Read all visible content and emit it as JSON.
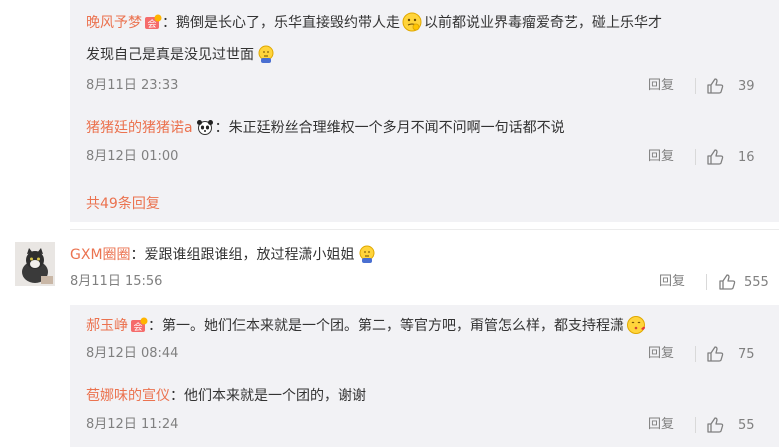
{
  "colors": {
    "username": "#eb7350",
    "meta": "#808080",
    "reply_bg": "#f2f2f5",
    "text": "#333333"
  },
  "thread1": {
    "replies": [
      {
        "user": "晚风予梦",
        "badge_icon": "vip-badge-icon",
        "text_a": "：鹅倒是长心了，乐华直接毁约带人走",
        "emoji_1": "thinking-face-icon",
        "text_b": "以前都说业界毒瘤爱奇艺，碰上乐华才",
        "text_c": "发现自己是真是没见过世面",
        "emoji_2": "sweat-face-icon",
        "time": "8月11日 23:33",
        "reply_label": "回复",
        "likes": "39"
      },
      {
        "user": "猪猪廷的猪猪诺a",
        "badge_icon": "panda-icon",
        "text_a": "：朱正廷粉丝合理维权一个多月不闻不问啊一句话都不说",
        "time": "8月12日 01:00",
        "reply_label": "回复",
        "likes": "16"
      }
    ],
    "more_label": "共49条回复"
  },
  "comment2": {
    "user": "GXM圈圈",
    "text": "：爱跟谁组跟谁组，放过程潇小姐姐",
    "emoji": "sweat-face-icon",
    "time": "8月11日 15:56",
    "reply_label": "回复",
    "likes": "555",
    "avatar_icon": "cat-avatar-icon",
    "replies": [
      {
        "user": "郝玉峥",
        "badge_icon": "vip-badge-icon",
        "text_a": "：第一。她们仨本来就是一个团。第二，等官方吧，甭管怎么样，都支持程潇",
        "emoji_1": "heart-kiss-face-icon",
        "time": "8月12日 08:44",
        "reply_label": "回复",
        "likes": "75"
      },
      {
        "user": "苞娜味的宣仪",
        "text_a": "：他们本来就是一个团的，谢谢",
        "time": "8月12日 11:24",
        "reply_label": "回复",
        "likes": "55"
      }
    ]
  }
}
